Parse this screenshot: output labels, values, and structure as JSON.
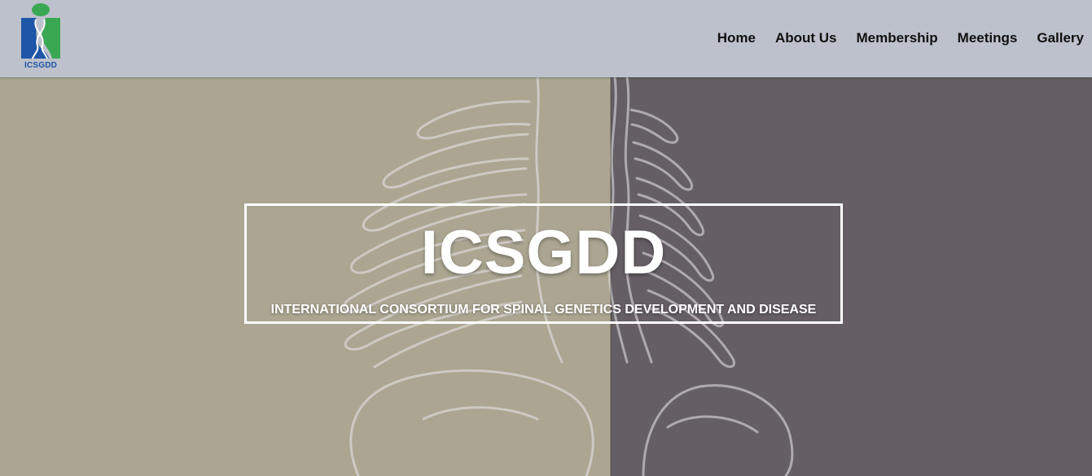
{
  "header": {
    "logo_text": "ICSGDD",
    "nav": [
      {
        "label": "Home"
      },
      {
        "label": "About Us"
      },
      {
        "label": "Membership"
      },
      {
        "label": "Meetings"
      },
      {
        "label": "Gallery"
      }
    ]
  },
  "hero": {
    "title": "ICSGDD",
    "subtitle": "INTERNATIONAL CONSORTIUM FOR SPINAL GENETICS DEVELOPMENT AND DISEASE"
  },
  "colors": {
    "header_bg": "#bdc1cc",
    "hero_left": "#aba591",
    "hero_right": "#655f65",
    "logo_green": "#3aa853",
    "logo_blue": "#1f56a8"
  }
}
